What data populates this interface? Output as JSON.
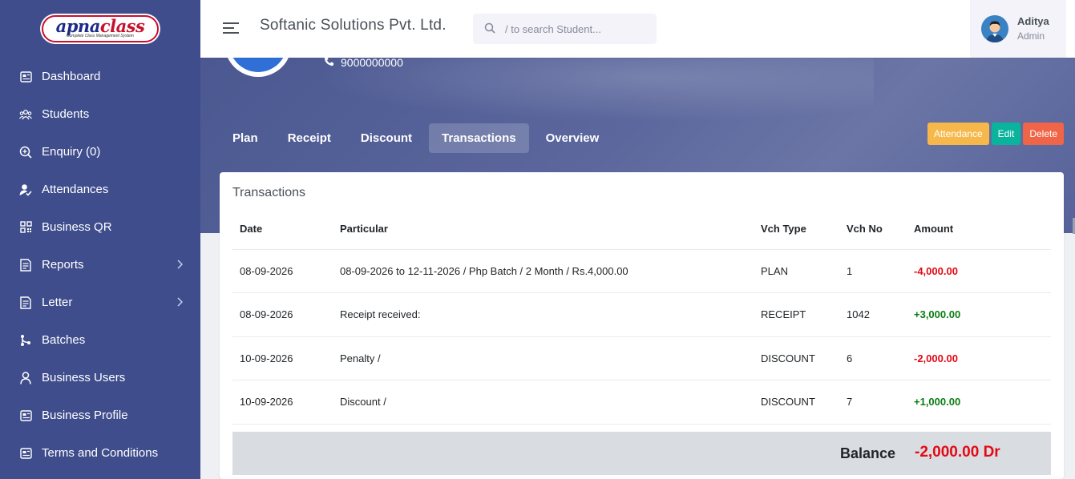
{
  "sidebar": {
    "logo_main_a": "apna",
    "logo_main_b": "class",
    "logo_tagline": "Complete Class Management System",
    "items": [
      {
        "label": "Dashboard",
        "icon": "dashboard-icon"
      },
      {
        "label": "Students",
        "icon": "users-icon"
      },
      {
        "label": "Enquiry (0)",
        "icon": "search-plus-icon"
      },
      {
        "label": "Attendances",
        "icon": "user-check-icon"
      },
      {
        "label": "Business QR",
        "icon": "qr-icon"
      },
      {
        "label": "Reports",
        "icon": "report-icon",
        "has_submenu": true
      },
      {
        "label": "Letter",
        "icon": "letter-icon",
        "has_submenu": true
      },
      {
        "label": "Batches",
        "icon": "git-branch-icon"
      },
      {
        "label": "Business Users",
        "icon": "user-icon"
      },
      {
        "label": "Business Profile",
        "icon": "profile-icon"
      },
      {
        "label": "Terms and Conditions",
        "icon": "terms-icon"
      }
    ]
  },
  "header": {
    "company": "Softanic Solutions Pvt. Ltd.",
    "search_placeholder": "/ to search Student...",
    "user_name": "Aditya",
    "user_role": "Admin"
  },
  "profile": {
    "phone": "9000000000"
  },
  "tabs": [
    {
      "label": "Plan",
      "active": false
    },
    {
      "label": "Receipt",
      "active": false
    },
    {
      "label": "Discount",
      "active": false
    },
    {
      "label": "Transactions",
      "active": true
    },
    {
      "label": "Overview",
      "active": false
    }
  ],
  "actions": {
    "attendance": "Attendance",
    "edit": "Edit",
    "delete": "Delete"
  },
  "transactions": {
    "title": "Transactions",
    "columns": [
      "Date",
      "Particular",
      "Vch Type",
      "Vch No",
      "Amount"
    ],
    "rows": [
      {
        "date": "08-09-2026",
        "particular": "08-09-2026 to 12-11-2026 / Php Batch / 2 Month / Rs.4,000.00",
        "vch_type": "PLAN",
        "vch_no": "1",
        "amount": "-4,000.00",
        "sign": "neg"
      },
      {
        "date": "08-09-2026",
        "particular": "Receipt received:",
        "vch_type": "RECEIPT",
        "vch_no": "1042",
        "amount": "+3,000.00",
        "sign": "pos"
      },
      {
        "date": "10-09-2026",
        "particular": "Penalty /",
        "vch_type": "DISCOUNT",
        "vch_no": "6",
        "amount": "-2,000.00",
        "sign": "neg"
      },
      {
        "date": "10-09-2026",
        "particular": "Discount /",
        "vch_type": "DISCOUNT",
        "vch_no": "7",
        "amount": "+1,000.00",
        "sign": "pos"
      }
    ],
    "balance_label": "Balance",
    "balance_value": "-2,000.00 Dr"
  },
  "colors": {
    "sidebar": "#3f4d8c",
    "negative": "#e50914",
    "positive": "#0a7d12",
    "attendance_btn": "#f7b84b",
    "edit_btn": "#0ab39c",
    "delete_btn": "#f06548"
  }
}
